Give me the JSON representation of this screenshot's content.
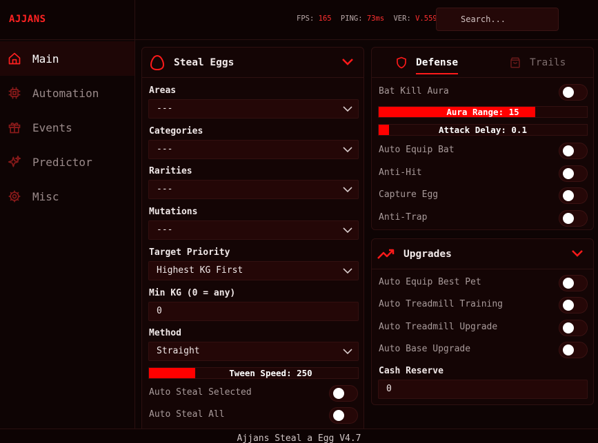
{
  "app": {
    "brand": "AJJANS",
    "footer": "Ajjans Steal a Egg V4.7"
  },
  "stats": [
    {
      "label": "FPS:",
      "value": "165"
    },
    {
      "label": "PING:",
      "value": "73ms"
    },
    {
      "label": "VER:",
      "value": "V.559"
    }
  ],
  "search": {
    "placeholder": "Search..."
  },
  "sidebar": {
    "items": [
      {
        "label": "Main",
        "icon": "home-icon",
        "active": true
      },
      {
        "label": "Automation",
        "icon": "chip-icon"
      },
      {
        "label": "Events",
        "icon": "gift-icon"
      },
      {
        "label": "Predictor",
        "icon": "sparkles-icon"
      },
      {
        "label": "Misc",
        "icon": "gear-icon"
      }
    ]
  },
  "steal_eggs": {
    "title": "Steal Eggs",
    "icon": "egg-icon",
    "areas": {
      "label": "Areas",
      "value": "---"
    },
    "categories": {
      "label": "Categories",
      "value": "---"
    },
    "rarities": {
      "label": "Rarities",
      "value": "---"
    },
    "mutations": {
      "label": "Mutations",
      "value": "---"
    },
    "target_priority": {
      "label": "Target Priority",
      "value": "Highest KG First"
    },
    "min_kg": {
      "label": "Min KG (0 = any)",
      "value": "0"
    },
    "method": {
      "label": "Method",
      "value": "Straight"
    },
    "tween_speed": {
      "label": "Tween Speed: 250",
      "fraction": 0.22
    },
    "auto_steal_selected": {
      "label": "Auto Steal Selected",
      "on": false
    },
    "auto_steal_all": {
      "label": "Auto Steal All",
      "on": false
    }
  },
  "defense": {
    "tabs": [
      {
        "label": "Defense",
        "icon": "shield-icon",
        "active": true
      },
      {
        "label": "Trails",
        "icon": "bag-icon",
        "active": false
      }
    ],
    "bat_kill_aura": {
      "label": "Bat Kill Aura",
      "on": false
    },
    "aura_range": {
      "label": "Aura Range: 15",
      "fraction": 0.75
    },
    "attack_delay": {
      "label": "Attack Delay: 0.1",
      "fraction": 0.05
    },
    "auto_equip_bat": {
      "label": "Auto Equip Bat",
      "on": false
    },
    "anti_hit": {
      "label": "Anti-Hit",
      "on": false
    },
    "capture_egg": {
      "label": "Capture Egg",
      "on": false
    },
    "anti_trap": {
      "label": "Anti-Trap",
      "on": false
    }
  },
  "upgrades": {
    "title": "Upgrades",
    "icon": "trending-up-icon",
    "auto_equip_best_pet": {
      "label": "Auto Equip Best Pet",
      "on": false
    },
    "auto_treadmill_training": {
      "label": "Auto Treadmill Training",
      "on": false
    },
    "auto_treadmill_upgrade": {
      "label": "Auto Treadmill Upgrade",
      "on": false
    },
    "auto_base_upgrade": {
      "label": "Auto Base Upgrade",
      "on": false
    },
    "cash_reserve": {
      "label": "Cash Reserve",
      "value": "0"
    }
  },
  "colors": {
    "accent": "#ff1a1a",
    "background": "#0e0404",
    "panel": "#140505"
  }
}
